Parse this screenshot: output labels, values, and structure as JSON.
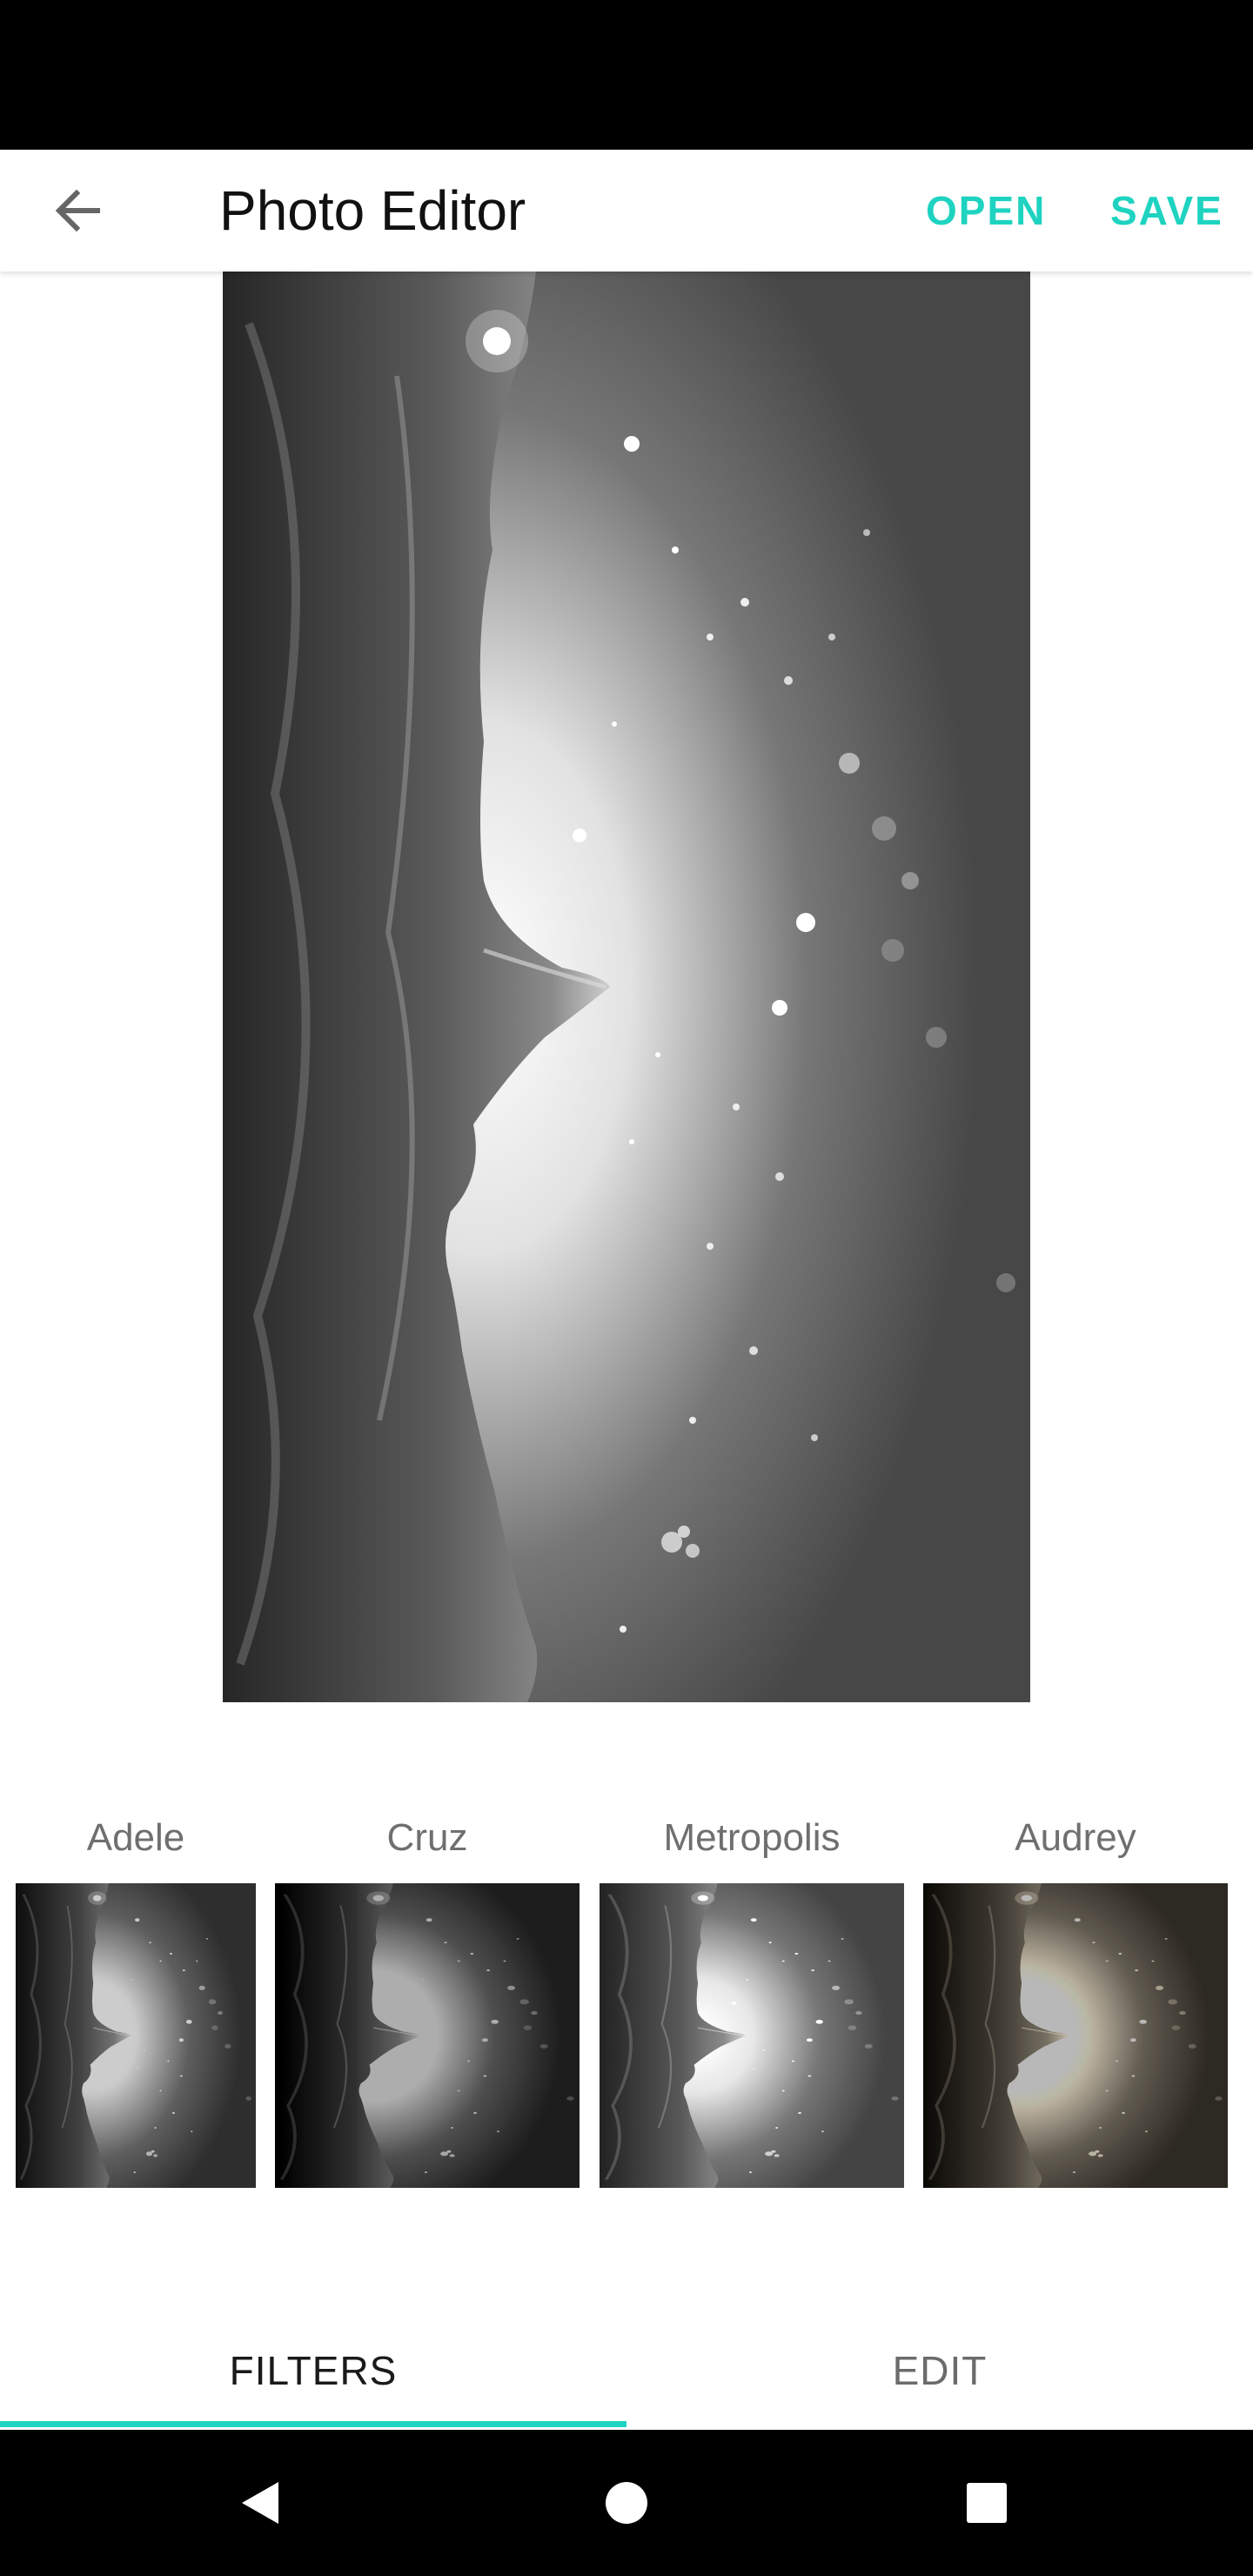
{
  "theme": {
    "accent": "#1ed3c0",
    "tab_active_text": "#1a1a1a",
    "tab_inactive_text": "#6b6b6b"
  },
  "app_bar": {
    "title": "Photo Editor",
    "back_icon": "arrow-back-icon",
    "open_label": "OPEN",
    "save_label": "SAVE"
  },
  "filters": [
    {
      "label": "Adele"
    },
    {
      "label": "Cruz"
    },
    {
      "label": "Metropolis"
    },
    {
      "label": "Audrey"
    }
  ],
  "tabs": [
    {
      "label": "FILTERS",
      "active": true
    },
    {
      "label": "EDIT",
      "active": false
    }
  ],
  "system_nav": {
    "back_icon": "triangle-back-icon",
    "home_icon": "circle-home-icon",
    "recents_icon": "square-recents-icon"
  }
}
